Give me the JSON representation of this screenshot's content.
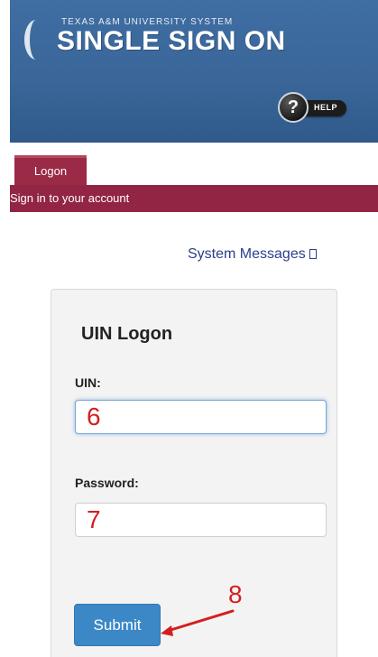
{
  "header": {
    "system_label": "TEXAS A&M UNIVERSITY SYSTEM",
    "title": "SINGLE SIGN ON",
    "help_label": "HELP",
    "help_symbol": "?"
  },
  "tabs": [
    {
      "label": "Logon",
      "active": true
    }
  ],
  "subheader": {
    "text": "Sign in to your account"
  },
  "system_messages": {
    "label": "System Messages"
  },
  "logon_form": {
    "title": "UIN Logon",
    "uin": {
      "label": "UIN:",
      "value": "6"
    },
    "password": {
      "label": "Password:",
      "value": "7"
    },
    "submit_label": "Submit"
  },
  "annotation": {
    "step_number": "8",
    "color": "#d31f1f"
  },
  "colors": {
    "header_blue": "#3a6699",
    "maroon": "#922543",
    "link_blue": "#2c3e8c",
    "button_blue": "#3c88c6"
  }
}
